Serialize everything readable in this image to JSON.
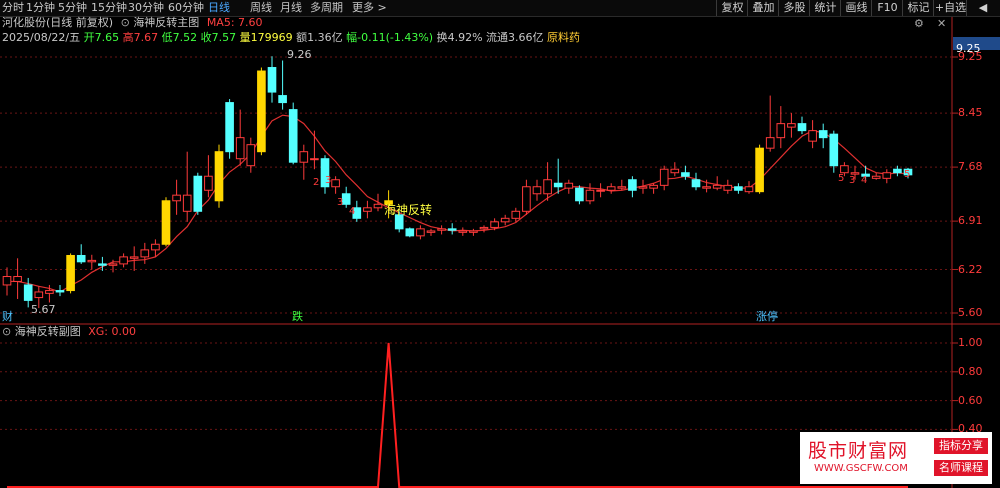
{
  "topbar": {
    "periods": [
      {
        "label": "分时",
        "active": false
      },
      {
        "label": "1分钟",
        "active": false
      },
      {
        "label": "5分钟",
        "active": false
      },
      {
        "label": "15分钟",
        "active": false
      },
      {
        "label": "30分钟",
        "active": false
      },
      {
        "label": "60分钟",
        "active": false
      },
      {
        "label": "日线",
        "active": true
      },
      {
        "label": "周线",
        "active": false
      },
      {
        "label": "月线",
        "active": false
      },
      {
        "label": "多周期",
        "active": false
      },
      {
        "label": "更多",
        "active": false
      }
    ],
    "more_arrow": ">",
    "tools": [
      "复权",
      "叠加",
      "多股",
      "统计",
      "画线",
      "F10",
      "标记",
      "+自选"
    ],
    "back_arrow": "◀"
  },
  "main_header": {
    "stock": "河化股份(日线 前复权)",
    "indicator_name": "海神反转主图",
    "ma_label": "MA5: 7.60",
    "date": "2025/08/22/五",
    "open": "开7.65",
    "high": "高7.67",
    "low": "低7.52",
    "close": "收7.57",
    "volume": "量179969",
    "amount": "额1.36亿",
    "change": "幅-0.11(-1.43%)",
    "turnover": "换4.92%",
    "float_cap": "流通3.66亿",
    "concept": "原料药",
    "settings_icon": "⚙",
    "close_icon": "✕"
  },
  "main_chart": {
    "ylevels": [
      9.25,
      8.45,
      7.68,
      6.91,
      6.22,
      5.6
    ],
    "ylabels": [
      "9.25",
      "8.45",
      "7.68",
      "6.91",
      "6.22",
      "5.60"
    ],
    "axis_current": "9.25",
    "high_mark": "9.26",
    "low_mark": "5.67",
    "signal_text": "海神反转",
    "bottom_badges": [
      {
        "text": "财",
        "color": "#4ec3ff"
      },
      {
        "text": "跌",
        "color": "#40ff40"
      },
      {
        "text": "涨停",
        "color": "#4ec3ff"
      }
    ],
    "countdown_labels": [
      "2",
      "3",
      "3",
      "4",
      "5",
      "3",
      "4",
      "5"
    ]
  },
  "sub_header": {
    "name": "海神反转副图",
    "xg_label": "XG: 0.00"
  },
  "sub_chart": {
    "ylabels": [
      "1.00",
      "0.80",
      "0.60",
      "0.40"
    ],
    "xg_values": [
      0,
      0,
      0,
      0,
      0,
      0,
      0,
      0,
      0,
      0,
      0,
      0,
      0,
      0,
      0,
      0,
      0,
      0,
      0,
      0,
      0,
      0,
      0,
      0,
      0,
      0,
      0,
      0,
      0,
      0,
      0,
      0,
      0,
      0,
      0,
      0,
      0,
      0,
      0,
      0,
      0,
      0,
      0,
      0,
      0,
      0,
      0,
      0,
      0,
      0,
      0,
      0,
      0,
      0,
      0,
      0,
      0,
      0,
      0,
      0,
      0,
      0,
      0,
      0,
      0,
      0,
      0,
      0,
      0,
      0,
      0,
      0,
      0,
      0,
      0,
      0,
      0,
      0,
      0,
      0,
      0,
      0,
      0,
      0,
      0,
      0,
      0,
      0,
      0,
      0,
      0,
      0,
      0,
      0,
      0,
      0,
      0,
      0,
      0,
      0,
      0,
      0,
      0,
      0,
      0,
      0,
      0,
      0,
      0,
      0,
      0,
      0,
      0,
      0,
      0,
      0,
      0,
      0,
      0,
      0,
      0,
      0,
      0,
      0,
      0,
      0,
      0,
      0,
      0,
      0,
      0,
      0,
      0,
      0,
      0,
      0,
      0,
      0,
      0,
      0,
      0,
      0,
      0,
      0,
      0,
      0,
      0,
      0,
      0,
      0
    ]
  },
  "chart_data": {
    "type": "candlestick",
    "series_ma_name": "MA5",
    "ylim": [
      5.55,
      9.35
    ],
    "candles": [
      {
        "o": 6.0,
        "h": 6.25,
        "l": 5.85,
        "c": 6.12,
        "k": "up"
      },
      {
        "o": 6.12,
        "h": 6.38,
        "l": 5.8,
        "c": 6.05,
        "k": "up"
      },
      {
        "o": 6.0,
        "h": 6.1,
        "l": 5.68,
        "c": 5.78,
        "k": "down"
      },
      {
        "o": 5.82,
        "h": 5.98,
        "l": 5.67,
        "c": 5.9,
        "k": "up"
      },
      {
        "o": 5.88,
        "h": 6.0,
        "l": 5.75,
        "c": 5.92,
        "k": "up"
      },
      {
        "o": 5.92,
        "h": 6.0,
        "l": 5.84,
        "c": 5.9,
        "k": "down"
      },
      {
        "o": 5.92,
        "h": 6.45,
        "l": 5.88,
        "c": 6.42,
        "k": "limit"
      },
      {
        "o": 6.42,
        "h": 6.58,
        "l": 6.3,
        "c": 6.33,
        "k": "down"
      },
      {
        "o": 6.33,
        "h": 6.43,
        "l": 6.22,
        "c": 6.35,
        "k": "up"
      },
      {
        "o": 6.3,
        "h": 6.4,
        "l": 6.2,
        "c": 6.28,
        "k": "down"
      },
      {
        "o": 6.28,
        "h": 6.36,
        "l": 6.18,
        "c": 6.3,
        "k": "up"
      },
      {
        "o": 6.3,
        "h": 6.45,
        "l": 6.25,
        "c": 6.4,
        "k": "up"
      },
      {
        "o": 6.38,
        "h": 6.55,
        "l": 6.2,
        "c": 6.4,
        "k": "up"
      },
      {
        "o": 6.4,
        "h": 6.6,
        "l": 6.3,
        "c": 6.5,
        "k": "up"
      },
      {
        "o": 6.5,
        "h": 6.65,
        "l": 6.4,
        "c": 6.58,
        "k": "up"
      },
      {
        "o": 6.58,
        "h": 7.25,
        "l": 6.55,
        "c": 7.2,
        "k": "limit"
      },
      {
        "o": 7.2,
        "h": 7.5,
        "l": 7.0,
        "c": 7.28,
        "k": "up"
      },
      {
        "o": 7.28,
        "h": 7.9,
        "l": 6.9,
        "c": 7.05,
        "k": "up"
      },
      {
        "o": 7.05,
        "h": 7.6,
        "l": 7.0,
        "c": 7.55,
        "k": "down"
      },
      {
        "o": 7.35,
        "h": 7.85,
        "l": 7.25,
        "c": 7.55,
        "k": "up"
      },
      {
        "o": 7.2,
        "h": 8.0,
        "l": 7.1,
        "c": 7.9,
        "k": "limit"
      },
      {
        "o": 7.9,
        "h": 8.65,
        "l": 7.8,
        "c": 8.6,
        "k": "down"
      },
      {
        "o": 8.1,
        "h": 8.5,
        "l": 7.7,
        "c": 7.8,
        "k": "up"
      },
      {
        "o": 7.7,
        "h": 8.1,
        "l": 7.6,
        "c": 8.0,
        "k": "up"
      },
      {
        "o": 7.9,
        "h": 9.1,
        "l": 7.85,
        "c": 9.05,
        "k": "limit"
      },
      {
        "o": 8.75,
        "h": 9.26,
        "l": 8.6,
        "c": 9.1,
        "k": "down"
      },
      {
        "o": 8.6,
        "h": 9.2,
        "l": 8.5,
        "c": 8.7,
        "k": "down"
      },
      {
        "o": 8.5,
        "h": 8.6,
        "l": 7.72,
        "c": 7.75,
        "k": "down"
      },
      {
        "o": 7.75,
        "h": 8.0,
        "l": 7.5,
        "c": 7.9,
        "k": "up"
      },
      {
        "o": 7.8,
        "h": 8.2,
        "l": 7.65,
        "c": 7.8,
        "k": "up"
      },
      {
        "o": 7.8,
        "h": 7.85,
        "l": 7.3,
        "c": 7.4,
        "k": "down"
      },
      {
        "o": 7.4,
        "h": 7.55,
        "l": 7.3,
        "c": 7.5,
        "k": "up"
      },
      {
        "o": 7.3,
        "h": 7.4,
        "l": 7.1,
        "c": 7.15,
        "k": "down"
      },
      {
        "o": 7.1,
        "h": 7.2,
        "l": 6.9,
        "c": 6.95,
        "k": "down"
      },
      {
        "o": 7.05,
        "h": 7.2,
        "l": 6.95,
        "c": 7.1,
        "k": "up"
      },
      {
        "o": 7.1,
        "h": 7.3,
        "l": 7.05,
        "c": 7.15,
        "k": "up"
      },
      {
        "o": 7.2,
        "h": 7.35,
        "l": 6.95,
        "c": 7.15,
        "k": "limit"
      },
      {
        "o": 7.0,
        "h": 7.05,
        "l": 6.75,
        "c": 6.8,
        "k": "down"
      },
      {
        "o": 6.8,
        "h": 6.82,
        "l": 6.68,
        "c": 6.7,
        "k": "down"
      },
      {
        "o": 6.7,
        "h": 6.85,
        "l": 6.65,
        "c": 6.8,
        "k": "up"
      },
      {
        "o": 6.75,
        "h": 6.8,
        "l": 6.7,
        "c": 6.77,
        "k": "up"
      },
      {
        "o": 6.8,
        "h": 6.85,
        "l": 6.72,
        "c": 6.78,
        "k": "up"
      },
      {
        "o": 6.78,
        "h": 6.88,
        "l": 6.72,
        "c": 6.8,
        "k": "down"
      },
      {
        "o": 6.77,
        "h": 6.82,
        "l": 6.7,
        "c": 6.75,
        "k": "up"
      },
      {
        "o": 6.75,
        "h": 6.8,
        "l": 6.7,
        "c": 6.77,
        "k": "up"
      },
      {
        "o": 6.8,
        "h": 6.85,
        "l": 6.75,
        "c": 6.82,
        "k": "up"
      },
      {
        "o": 6.82,
        "h": 6.95,
        "l": 6.78,
        "c": 6.9,
        "k": "up"
      },
      {
        "o": 6.9,
        "h": 7.0,
        "l": 6.85,
        "c": 6.95,
        "k": "up"
      },
      {
        "o": 6.95,
        "h": 7.1,
        "l": 6.9,
        "c": 7.05,
        "k": "up"
      },
      {
        "o": 7.05,
        "h": 7.5,
        "l": 7.0,
        "c": 7.4,
        "k": "up"
      },
      {
        "o": 7.3,
        "h": 7.5,
        "l": 7.2,
        "c": 7.4,
        "k": "up"
      },
      {
        "o": 7.3,
        "h": 7.75,
        "l": 7.2,
        "c": 7.5,
        "k": "up"
      },
      {
        "o": 7.4,
        "h": 7.8,
        "l": 7.3,
        "c": 7.45,
        "k": "down"
      },
      {
        "o": 7.45,
        "h": 7.5,
        "l": 7.3,
        "c": 7.38,
        "k": "up"
      },
      {
        "o": 7.38,
        "h": 7.42,
        "l": 7.15,
        "c": 7.2,
        "k": "down"
      },
      {
        "o": 7.2,
        "h": 7.45,
        "l": 7.15,
        "c": 7.35,
        "k": "up"
      },
      {
        "o": 7.35,
        "h": 7.45,
        "l": 7.25,
        "c": 7.35,
        "k": "up"
      },
      {
        "o": 7.35,
        "h": 7.45,
        "l": 7.3,
        "c": 7.4,
        "k": "up"
      },
      {
        "o": 7.4,
        "h": 7.5,
        "l": 7.35,
        "c": 7.38,
        "k": "up"
      },
      {
        "o": 7.35,
        "h": 7.55,
        "l": 7.25,
        "c": 7.5,
        "k": "down"
      },
      {
        "o": 7.4,
        "h": 7.5,
        "l": 7.3,
        "c": 7.38,
        "k": "up"
      },
      {
        "o": 7.38,
        "h": 7.45,
        "l": 7.3,
        "c": 7.42,
        "k": "up"
      },
      {
        "o": 7.42,
        "h": 7.7,
        "l": 7.35,
        "c": 7.65,
        "k": "up"
      },
      {
        "o": 7.65,
        "h": 7.75,
        "l": 7.55,
        "c": 7.6,
        "k": "up"
      },
      {
        "o": 7.6,
        "h": 7.7,
        "l": 7.5,
        "c": 7.55,
        "k": "down"
      },
      {
        "o": 7.5,
        "h": 7.6,
        "l": 7.35,
        "c": 7.4,
        "k": "down"
      },
      {
        "o": 7.4,
        "h": 7.5,
        "l": 7.32,
        "c": 7.38,
        "k": "up"
      },
      {
        "o": 7.38,
        "h": 7.55,
        "l": 7.35,
        "c": 7.42,
        "k": "up"
      },
      {
        "o": 7.42,
        "h": 7.5,
        "l": 7.3,
        "c": 7.35,
        "k": "up"
      },
      {
        "o": 7.35,
        "h": 7.45,
        "l": 7.3,
        "c": 7.4,
        "k": "down"
      },
      {
        "o": 7.4,
        "h": 7.48,
        "l": 7.3,
        "c": 7.33,
        "k": "up"
      },
      {
        "o": 7.33,
        "h": 8.0,
        "l": 7.3,
        "c": 7.95,
        "k": "limit"
      },
      {
        "o": 7.95,
        "h": 8.7,
        "l": 7.9,
        "c": 8.1,
        "k": "up"
      },
      {
        "o": 8.1,
        "h": 8.55,
        "l": 7.95,
        "c": 8.3,
        "k": "up"
      },
      {
        "o": 8.25,
        "h": 8.45,
        "l": 8.1,
        "c": 8.3,
        "k": "up"
      },
      {
        "o": 8.3,
        "h": 8.4,
        "l": 8.15,
        "c": 8.2,
        "k": "down"
      },
      {
        "o": 8.2,
        "h": 8.35,
        "l": 7.95,
        "c": 8.05,
        "k": "up"
      },
      {
        "o": 8.1,
        "h": 8.3,
        "l": 7.95,
        "c": 8.2,
        "k": "down"
      },
      {
        "o": 8.15,
        "h": 8.2,
        "l": 7.6,
        "c": 7.7,
        "k": "down"
      },
      {
        "o": 7.7,
        "h": 7.75,
        "l": 7.55,
        "c": 7.6,
        "k": "up"
      },
      {
        "o": 7.6,
        "h": 7.7,
        "l": 7.5,
        "c": 7.58,
        "k": "up"
      },
      {
        "o": 7.58,
        "h": 7.7,
        "l": 7.5,
        "c": 7.55,
        "k": "down"
      },
      {
        "o": 7.55,
        "h": 7.6,
        "l": 7.5,
        "c": 7.52,
        "k": "up"
      },
      {
        "o": 7.52,
        "h": 7.65,
        "l": 7.45,
        "c": 7.6,
        "k": "up"
      },
      {
        "o": 7.6,
        "h": 7.7,
        "l": 7.55,
        "c": 7.65,
        "k": "down"
      },
      {
        "o": 7.65,
        "h": 7.67,
        "l": 7.52,
        "c": 7.57,
        "k": "down"
      }
    ],
    "ma5": [
      6.05,
      6.05,
      6.02,
      5.98,
      5.95,
      5.9,
      5.99,
      6.07,
      6.18,
      6.26,
      6.33,
      6.33,
      6.35,
      6.36,
      6.4,
      6.52,
      6.69,
      6.83,
      7.06,
      7.21,
      7.44,
      7.61,
      7.72,
      7.87,
      8.12,
      8.34,
      8.42,
      8.4,
      8.3,
      8.12,
      7.91,
      7.76,
      7.57,
      7.42,
      7.26,
      7.18,
      7.1,
      7.03,
      6.96,
      6.89,
      6.83,
      6.8,
      6.77,
      6.78,
      6.77,
      6.78,
      6.8,
      6.83,
      6.89,
      7.01,
      7.13,
      7.24,
      7.33,
      7.4,
      7.4,
      7.38,
      7.37,
      7.34,
      7.35,
      7.38,
      7.41,
      7.45,
      7.51,
      7.52,
      7.55,
      7.51,
      7.46,
      7.43,
      7.4,
      7.38,
      7.38,
      7.5,
      7.66,
      7.82,
      7.98,
      8.12,
      8.2,
      8.17,
      8.08,
      7.95,
      7.81,
      7.67,
      7.6,
      7.58,
      7.6,
      7.58
    ],
    "signal_candle_index": 36
  },
  "watermark": {
    "brand": "股市财富网",
    "url": "WWW.GSCFW.COM",
    "tag1": "指标分享",
    "tag2": "名师课程"
  }
}
